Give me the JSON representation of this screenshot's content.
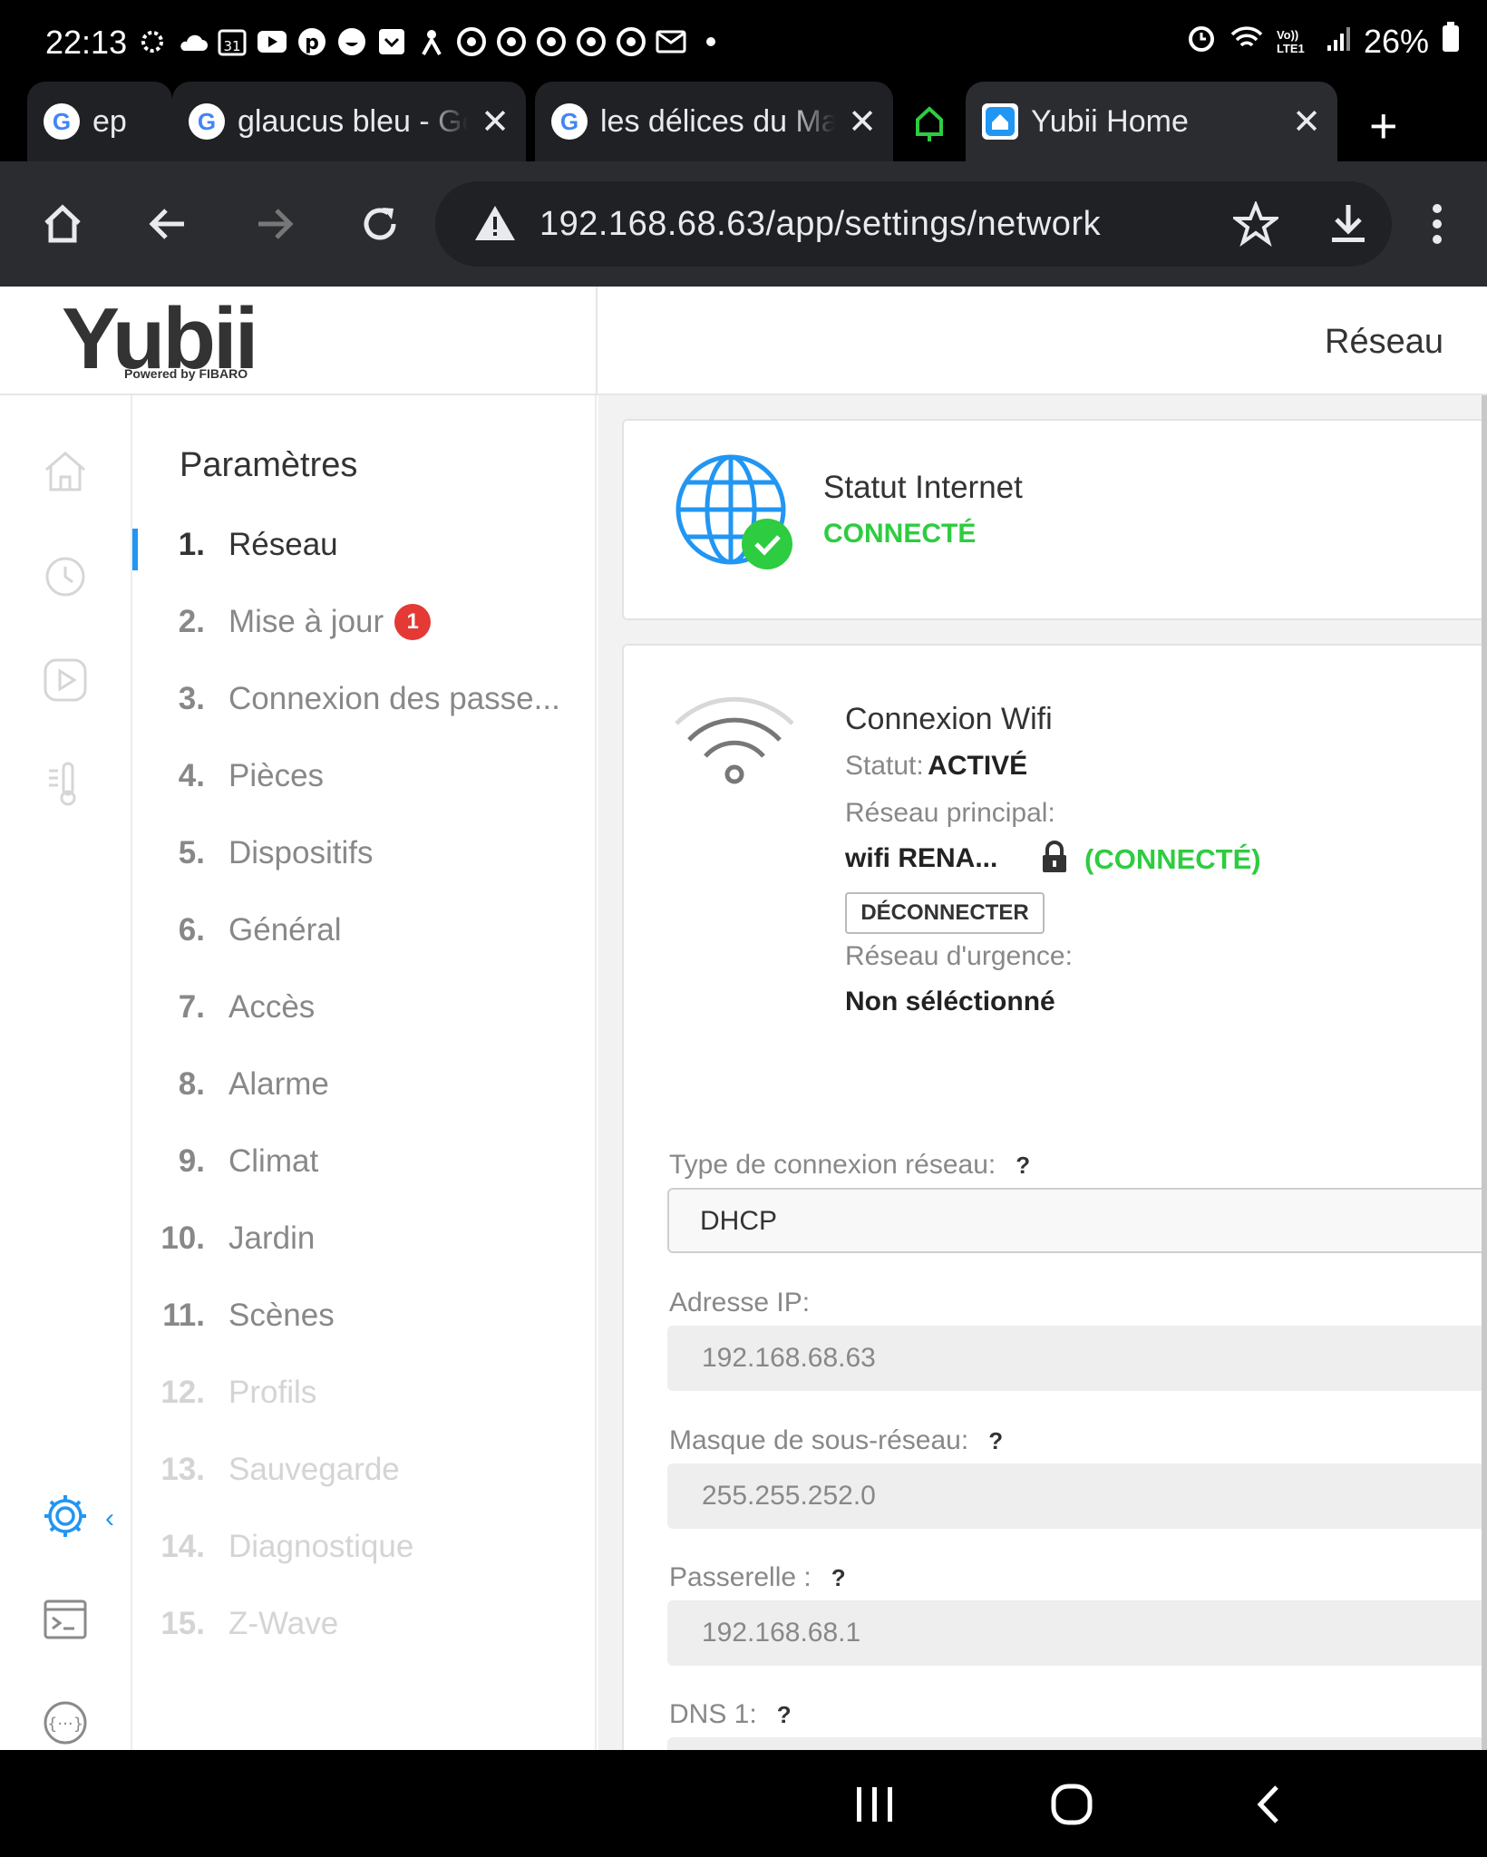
{
  "status_bar": {
    "time": "22:13",
    "calendar_day": "31",
    "battery": "26%",
    "network": "Vo)) LTE1"
  },
  "tabs": [
    {
      "title": "ep",
      "icon": "google-icon"
    },
    {
      "title": "glaucus bleu - Google",
      "icon": "google-icon"
    },
    {
      "title": "les délices du Maroc",
      "icon": "google-icon"
    },
    {
      "title": "Yubii Home",
      "icon": "home-app-icon"
    }
  ],
  "omnibox": {
    "url": "192.168.68.63/app/settings/network"
  },
  "header": {
    "logo": "Yubii",
    "logo_sub": "Powered by FIBARO",
    "title": "Réseau"
  },
  "menu": {
    "title": "Paramètres",
    "items": [
      {
        "num": "1.",
        "label": "Réseau"
      },
      {
        "num": "2.",
        "label": "Mise à jour",
        "badge": "1"
      },
      {
        "num": "3.",
        "label": "Connexion des passe..."
      },
      {
        "num": "4.",
        "label": "Pièces"
      },
      {
        "num": "5.",
        "label": "Dispositifs"
      },
      {
        "num": "6.",
        "label": "Général"
      },
      {
        "num": "7.",
        "label": "Accès"
      },
      {
        "num": "8.",
        "label": "Alarme"
      },
      {
        "num": "9.",
        "label": "Climat"
      },
      {
        "num": "10.",
        "label": "Jardin"
      },
      {
        "num": "11.",
        "label": "Scènes"
      },
      {
        "num": "12.",
        "label": "Profils"
      },
      {
        "num": "13.",
        "label": "Sauvegarde"
      },
      {
        "num": "14.",
        "label": "Diagnostique"
      },
      {
        "num": "15.",
        "label": "Z-Wave"
      }
    ]
  },
  "internet": {
    "title": "Statut Internet",
    "status": "CONNECTÉ"
  },
  "wifi": {
    "title": "Connexion Wifi",
    "status_label": "Statut:",
    "status_value": "ACTIVÉ",
    "main_label": "Réseau principal:",
    "main_network": "wifi RENA...",
    "main_state": "(CONNECTÉ)",
    "disconnect_button": "DÉCONNECTER",
    "emergency_label": "Réseau d'urgence:",
    "emergency_value": "Non séléctionné"
  },
  "form": {
    "conn_type_label": "Type de connexion réseau:",
    "conn_type_value": "DHCP",
    "ip_label": "Adresse IP:",
    "ip_value": "192.168.68.63",
    "mask_label": "Masque de sous-réseau:",
    "mask_value": "255.255.252.0",
    "gateway_label": "Passerelle :",
    "gateway_value": "192.168.68.1",
    "dns1_label": "DNS 1:",
    "help": "?"
  },
  "colors": {
    "accent": "#2196f3",
    "success": "#2ecc40",
    "badge": "#e53935"
  }
}
